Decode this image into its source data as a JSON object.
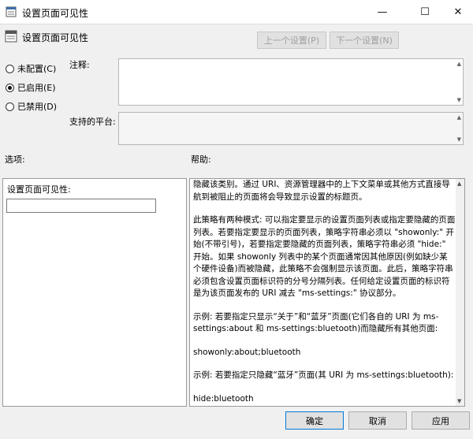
{
  "window": {
    "title": "设置页面可见性",
    "minimize": "—",
    "maximize": "☐",
    "close": "✕"
  },
  "header": {
    "title": "设置页面可见性",
    "prev_label": "上一个设置(P)",
    "next_label": "下一个设置(N)"
  },
  "state": {
    "options": [
      {
        "label": "未配置(C)",
        "selected": false
      },
      {
        "label": "已启用(E)",
        "selected": true
      },
      {
        "label": "已禁用(D)",
        "selected": false
      }
    ]
  },
  "comment": {
    "label": "注释:",
    "value": ""
  },
  "platform": {
    "label": "支持的平台:",
    "value": ""
  },
  "options_panel": {
    "section_label": "选项:",
    "field_label": "设置页面可见性:",
    "field_value": ""
  },
  "help_panel": {
    "section_label": "帮助:",
    "paragraphs": [
      "隐藏该类别。通过 URI、资源管理器中的上下文菜单或其他方式直接导航到被阻止的页面将会导致显示设置的标题页。",
      "此策略有两种模式: 可以指定要显示的设置页面列表或指定要隐藏的页面列表。若要指定要显示的页面列表，策略字符串必须以 \"showonly:\" 开始(不带引号)，若要指定要隐藏的页面列表，策略字符串必须 \"hide:\" 开始。如果 showonly 列表中的某个页面通常因其他原因(例如缺少某个硬件设备)而被隐藏，此策略不会强制显示该页面。此后，策略字符串必须包含设置页面标识符的分号分隔列表。任何给定设置页面的标识符是为该页面发布的 URI 减去 \"ms-settings:\" 协议部分。",
      "示例: 若要指定只显示“关于”和“蓝牙”页面(它们各自的 URI 为 ms-settings:about 和 ms-settings:bluetooth)而隐藏所有其他页面:",
      "showonly:about;bluetooth",
      "示例: 若要指定只隐藏“蓝牙”页面(其 URI 为 ms-settings:bluetooth):",
      "hide:bluetooth"
    ]
  },
  "buttons": {
    "ok": "确定",
    "cancel": "取消",
    "apply": "应用"
  }
}
